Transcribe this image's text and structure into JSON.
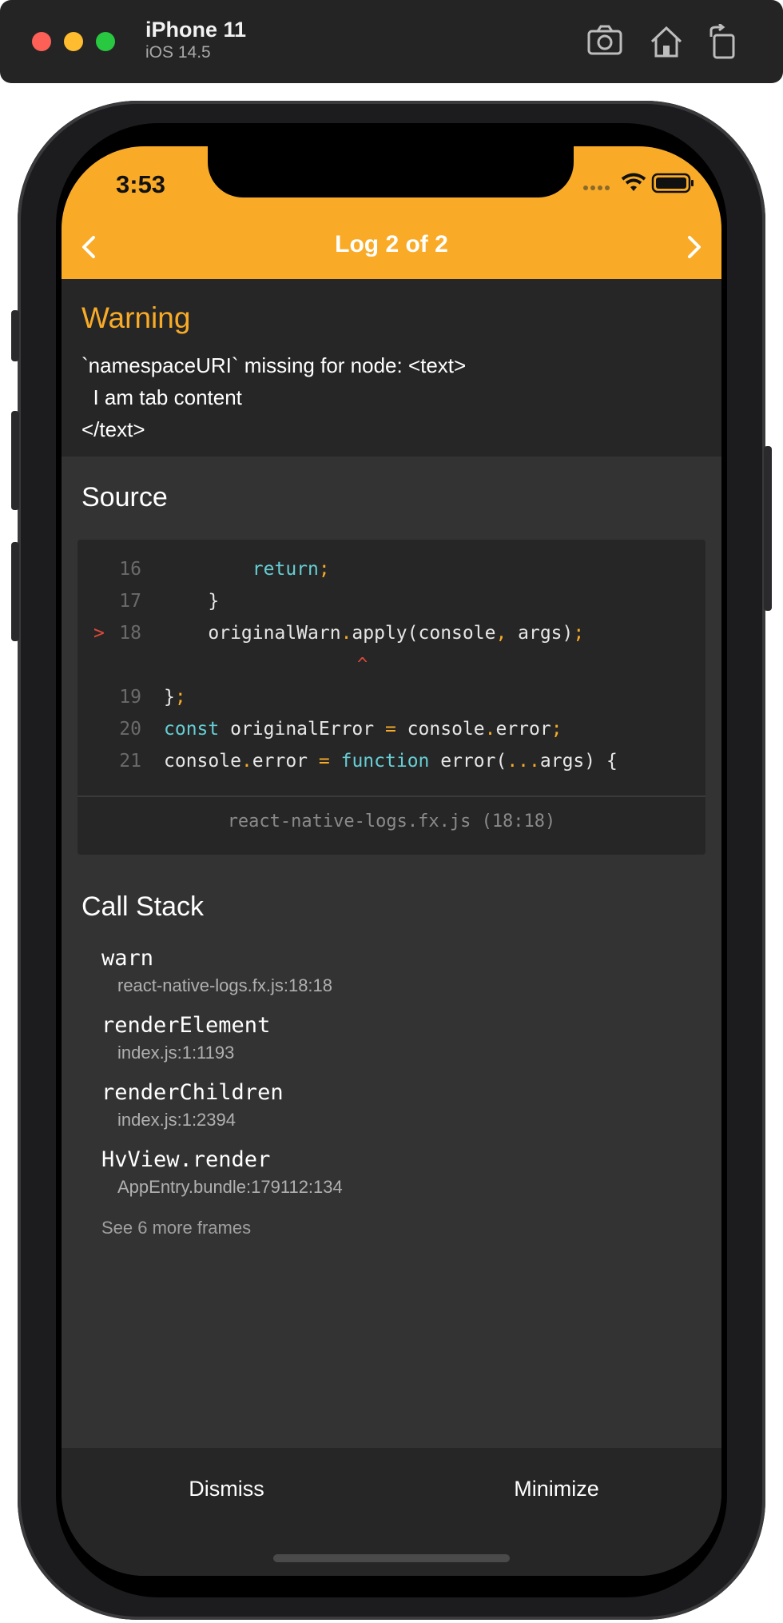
{
  "simulator": {
    "device_name": "iPhone 11",
    "os_version": "iOS 14.5",
    "icons": [
      "screenshot-icon",
      "home-icon",
      "rotate-icon"
    ]
  },
  "status_bar": {
    "time": "3:53"
  },
  "nav": {
    "title": "Log 2 of 2",
    "prev_icon": "chevron-left-icon",
    "next_icon": "chevron-right-icon"
  },
  "warning": {
    "level": "Warning",
    "message": "`namespaceURI` missing for node: <text>\n  I am tab content\n</text>"
  },
  "source": {
    "heading": "Source",
    "lines": [
      {
        "num": "16",
        "marker": "",
        "tokens": [
          {
            "t": "        ",
            "c": ""
          },
          {
            "t": "return",
            "c": "kw"
          },
          {
            "t": ";",
            "c": "pn"
          }
        ]
      },
      {
        "num": "17",
        "marker": "",
        "tokens": [
          {
            "t": "    }",
            "c": ""
          }
        ]
      },
      {
        "num": "18",
        "marker": ">",
        "tokens": [
          {
            "t": "    originalWarn",
            "c": ""
          },
          {
            "t": ".",
            "c": "pn"
          },
          {
            "t": "apply(console",
            "c": ""
          },
          {
            "t": ",",
            "c": "pn"
          },
          {
            "t": " args)",
            "c": ""
          },
          {
            "t": ";",
            "c": "pn"
          }
        ]
      },
      {
        "num": "19",
        "marker": "",
        "tokens": [
          {
            "t": "}",
            "c": ""
          },
          {
            "t": ";",
            "c": "pn"
          }
        ]
      },
      {
        "num": "20",
        "marker": "",
        "tokens": [
          {
            "t": "const",
            "c": "kw"
          },
          {
            "t": " originalError ",
            "c": ""
          },
          {
            "t": "=",
            "c": "pn"
          },
          {
            "t": " console",
            "c": ""
          },
          {
            "t": ".",
            "c": "pn"
          },
          {
            "t": "error",
            "c": ""
          },
          {
            "t": ";",
            "c": "pn"
          }
        ]
      },
      {
        "num": "21",
        "marker": "",
        "tokens": [
          {
            "t": "console",
            "c": ""
          },
          {
            "t": ".",
            "c": "pn"
          },
          {
            "t": "error ",
            "c": ""
          },
          {
            "t": "=",
            "c": "pn"
          },
          {
            "t": " ",
            "c": ""
          },
          {
            "t": "function",
            "c": "kw"
          },
          {
            "t": " error(",
            "c": ""
          },
          {
            "t": "...",
            "c": "pn"
          },
          {
            "t": "args) {",
            "c": ""
          }
        ]
      }
    ],
    "caret": "^",
    "file": "react-native-logs.fx.js (18:18)"
  },
  "call_stack": {
    "heading": "Call Stack",
    "frames": [
      {
        "fn": "warn",
        "loc": "react-native-logs.fx.js:18:18"
      },
      {
        "fn": "renderElement",
        "loc": "index.js:1:1193"
      },
      {
        "fn": "renderChildren",
        "loc": "index.js:1:2394"
      },
      {
        "fn": "HvView.render",
        "loc": "AppEntry.bundle:179112:134"
      }
    ],
    "more": "See 6 more frames"
  },
  "actions": {
    "dismiss": "Dismiss",
    "minimize": "Minimize"
  },
  "colors": {
    "accent": "#f9ab27",
    "error_marker": "#e04a3a",
    "keyword": "#66ced4"
  }
}
